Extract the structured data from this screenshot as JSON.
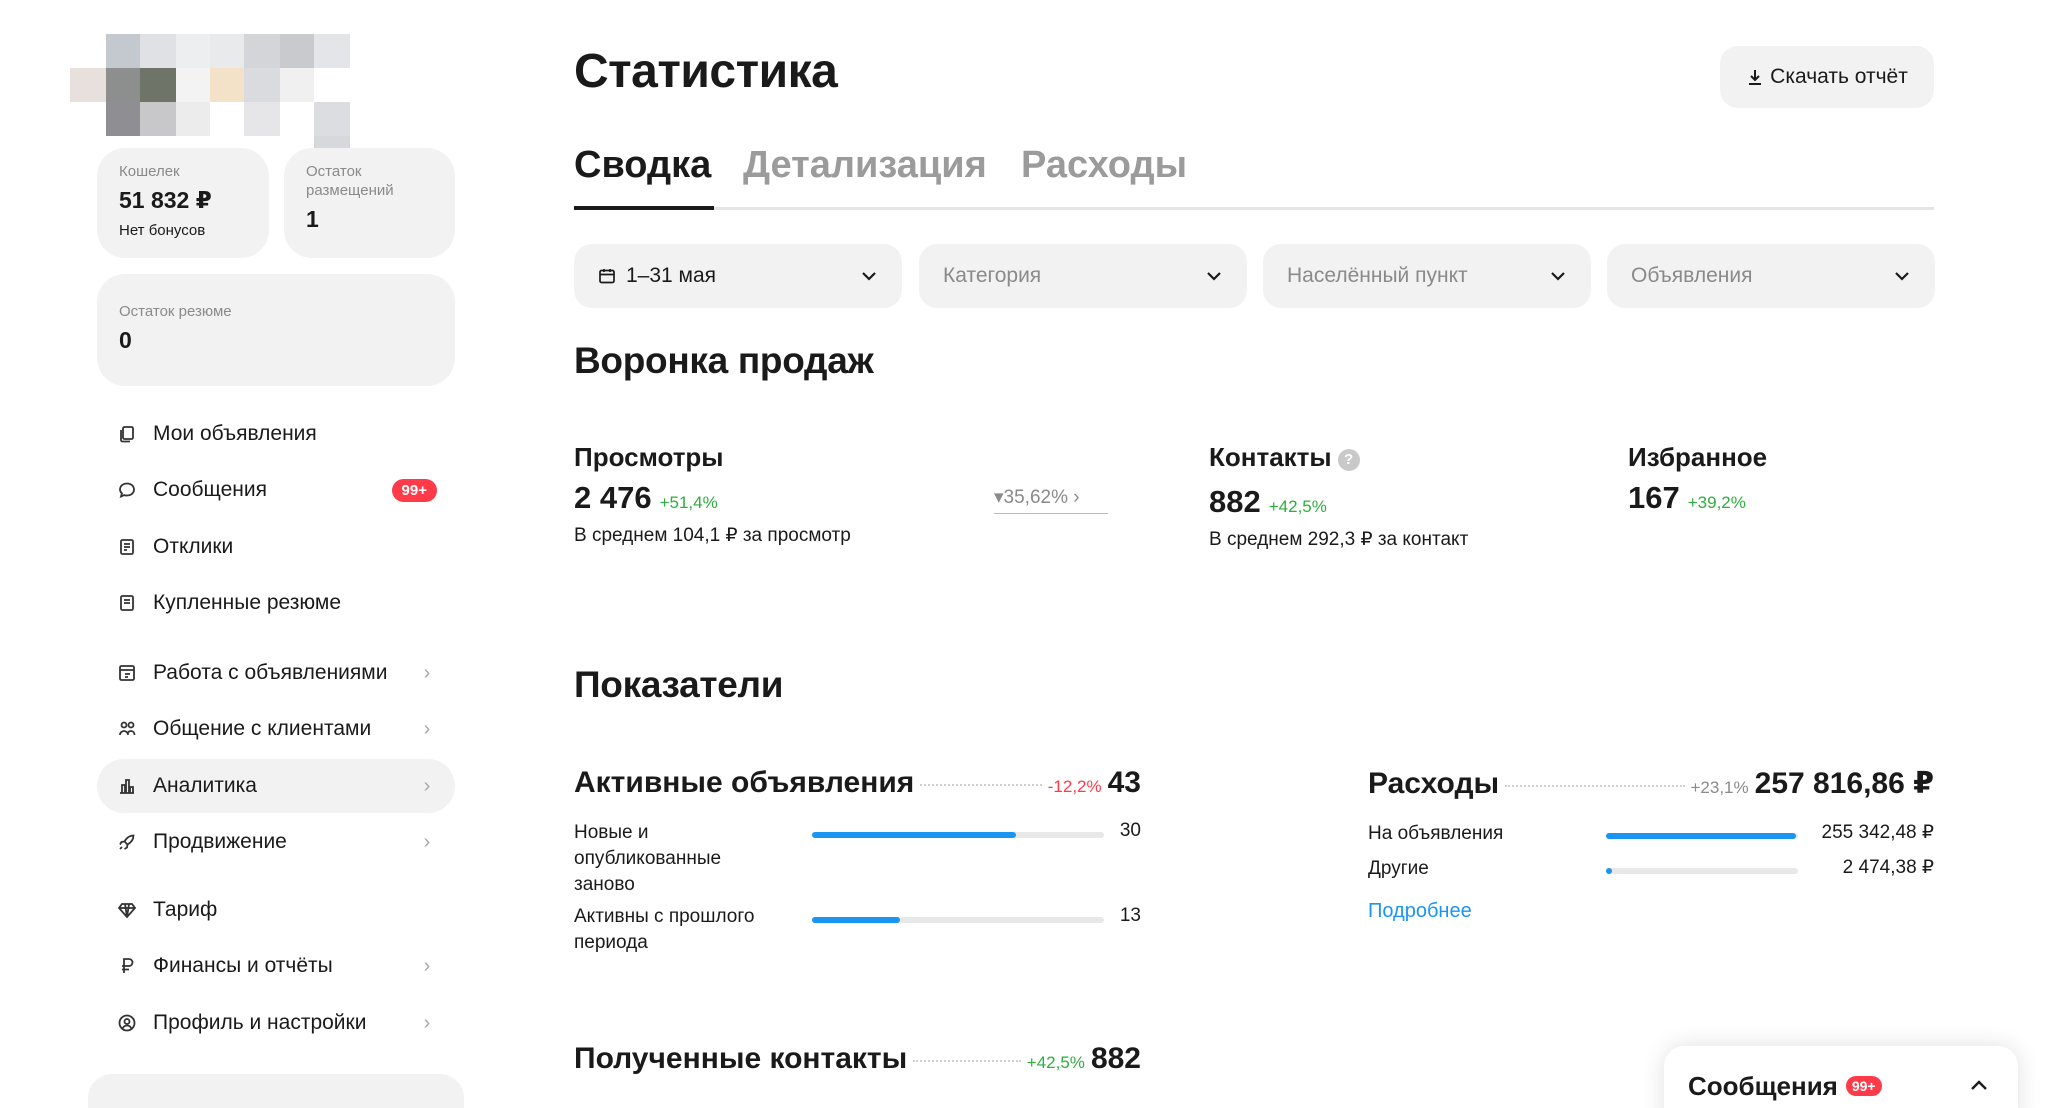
{
  "sidebar": {
    "wallet": {
      "label": "Кошелек",
      "value": "51 832 ₽",
      "bonus": "Нет бонусов"
    },
    "placements": {
      "label": "Остаток размещений",
      "value": "1"
    },
    "resumes": {
      "label": "Остаток резюме",
      "value": "0"
    },
    "items": [
      {
        "label": "Мои объявления",
        "icon": "copy-icon"
      },
      {
        "label": "Сообщения",
        "icon": "chat-icon",
        "badge": "99+"
      },
      {
        "label": "Отклики",
        "icon": "response-icon"
      },
      {
        "label": "Купленные резюме",
        "icon": "resume-icon"
      },
      {
        "label": "Работа с объявлениями",
        "icon": "ads-work-icon"
      },
      {
        "label": "Общение с клиентами",
        "icon": "people-icon"
      },
      {
        "label": "Аналитика",
        "icon": "chart-icon"
      },
      {
        "label": "Продвижение",
        "icon": "rocket-icon"
      },
      {
        "label": "Тариф",
        "icon": "diamond-icon"
      },
      {
        "label": "Финансы и отчёты",
        "icon": "ruble-icon"
      },
      {
        "label": "Профиль и настройки",
        "icon": "profile-icon"
      }
    ]
  },
  "header": {
    "title": "Статистика",
    "download_label": "Скачать отчёт"
  },
  "tabs": [
    {
      "label": "Сводка"
    },
    {
      "label": "Детализация"
    },
    {
      "label": "Расходы"
    }
  ],
  "filters": {
    "period": "1–31 мая",
    "category": "Категория",
    "city": "Населённый пункт",
    "ads": "Объявления"
  },
  "funnel": {
    "title": "Воронка продаж",
    "views": {
      "label": "Просмотры",
      "value": "2 476",
      "change": "+51,4%",
      "avg": "В среднем 104,1 ₽ за просмотр"
    },
    "conversion": "35,62%",
    "contacts": {
      "label": "Контакты",
      "help": "?",
      "value": "882",
      "change": "+42,5%",
      "avg": "В среднем 292,3 ₽ за контакт"
    },
    "favorites": {
      "label": "Избранное",
      "value": "167",
      "change": "+39,2%"
    }
  },
  "indicators": {
    "title": "Показатели",
    "active_ads": {
      "label": "Активные объявления",
      "change": "-12,2%",
      "value": "43",
      "rows": [
        {
          "label": "Новые и опубликованные заново",
          "value": "30",
          "fraction": 0.7
        },
        {
          "label": "Активны с прошлого периода",
          "value": "13",
          "fraction": 0.3
        }
      ]
    },
    "expenses": {
      "label": "Расходы",
      "change": "+23,1%",
      "value": "257 816,86 ₽",
      "rows": [
        {
          "label": "На объявления",
          "value": "255 342,48 ₽",
          "fraction": 0.99
        },
        {
          "label": "Другие",
          "value": "2 474,38 ₽",
          "fraction": 0.03
        }
      ],
      "more_link": "Подробнее"
    },
    "contacts": {
      "label": "Полученные контакты",
      "change": "+42,5%",
      "value": "882"
    }
  },
  "messages_widget": {
    "label": "Сообщения",
    "badge": "99+"
  },
  "colors": {
    "accent": "#1b95f2",
    "positive": "#2fae3e",
    "negative": "#ff3b4a",
    "surface": "#f2f2f2"
  }
}
